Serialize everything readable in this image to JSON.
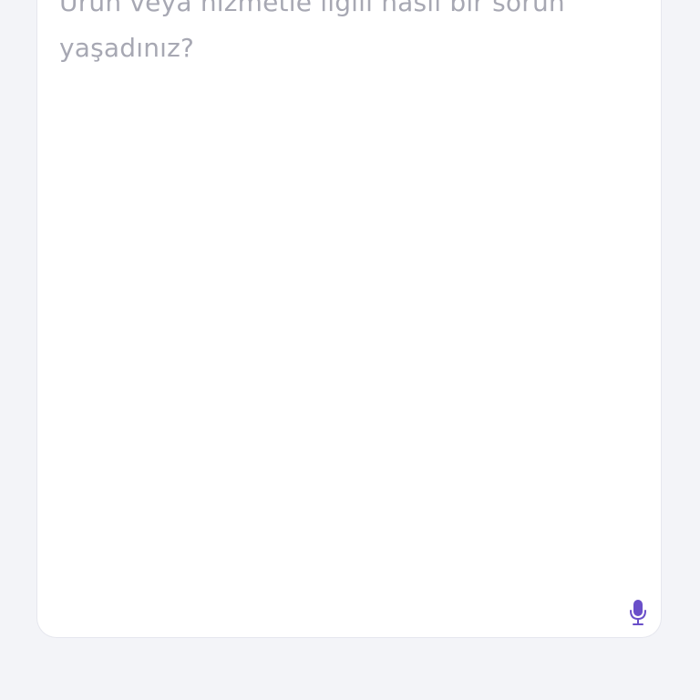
{
  "feedback": {
    "textarea_value": "",
    "placeholder": "Ürün veya hizmetle ilgili nasıl bir sorun yaşadınız?",
    "mic_icon": "microphone-icon"
  },
  "colors": {
    "background": "#f3f4f8",
    "card": "#ffffff",
    "placeholder_text": "#a7a8b3",
    "accent": "#6a4fc9"
  }
}
